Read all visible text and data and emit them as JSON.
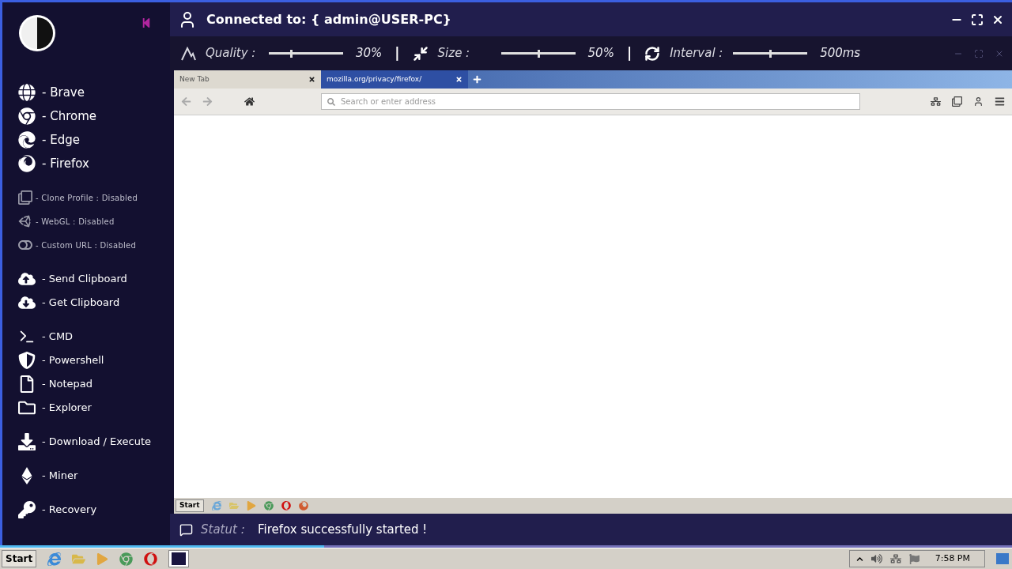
{
  "sidebar": {
    "groups": [
      {
        "items": [
          {
            "kind": "browser",
            "label": "- Brave"
          },
          {
            "kind": "browser",
            "label": "- Chrome"
          },
          {
            "kind": "browser",
            "label": "- Edge"
          },
          {
            "kind": "browser",
            "label": "- Firefox"
          }
        ]
      },
      {
        "items": [
          {
            "kind": "option",
            "label": "- Clone Profile : Disabled"
          },
          {
            "kind": "option",
            "label": "- WebGL : Disabled"
          },
          {
            "kind": "option",
            "label": "- Custom URL : Disabled"
          }
        ]
      },
      {
        "items": [
          {
            "kind": "action",
            "label": "- Send Clipboard"
          },
          {
            "kind": "action",
            "label": "- Get Clipboard"
          }
        ]
      },
      {
        "items": [
          {
            "kind": "action",
            "label": "- CMD"
          },
          {
            "kind": "action",
            "label": "- Powershell"
          },
          {
            "kind": "action",
            "label": "- Notepad"
          },
          {
            "kind": "action",
            "label": "- Explorer"
          }
        ]
      },
      {
        "items": [
          {
            "kind": "action",
            "label": "- Download / Execute"
          }
        ]
      },
      {
        "items": [
          {
            "kind": "action",
            "label": "- Miner"
          }
        ]
      },
      {
        "items": [
          {
            "kind": "action",
            "label": "- Recovery"
          }
        ]
      }
    ]
  },
  "header": {
    "title": "Connected to: { admin@USER-PC}"
  },
  "toolbar": {
    "items": [
      {
        "kind": "slider",
        "label": "Quality :",
        "level": 0.3,
        "reading": "30%"
      },
      {
        "kind": "separator",
        "label": "|"
      },
      {
        "kind": "slider",
        "label": "Size :",
        "level": 0.5,
        "reading": "50%"
      },
      {
        "kind": "separator",
        "label": "|"
      },
      {
        "kind": "slider",
        "label": "Interval :",
        "level": 0.5,
        "reading": "500ms"
      }
    ]
  },
  "remote": {
    "tabs": [
      {
        "label": "New Tab",
        "selected": false
      },
      {
        "label": "mozilla.org/privacy/firefox/",
        "selected": true
      }
    ],
    "address": {
      "placeholder": "Search or enter address"
    },
    "taskbar": {
      "start": "Start"
    }
  },
  "status": {
    "label": "Statut :",
    "text": "Firefox successfully started !"
  },
  "progress": {
    "level": 0.32
  },
  "taskbar": {
    "start": "Start",
    "clock": "7:58 PM"
  }
}
